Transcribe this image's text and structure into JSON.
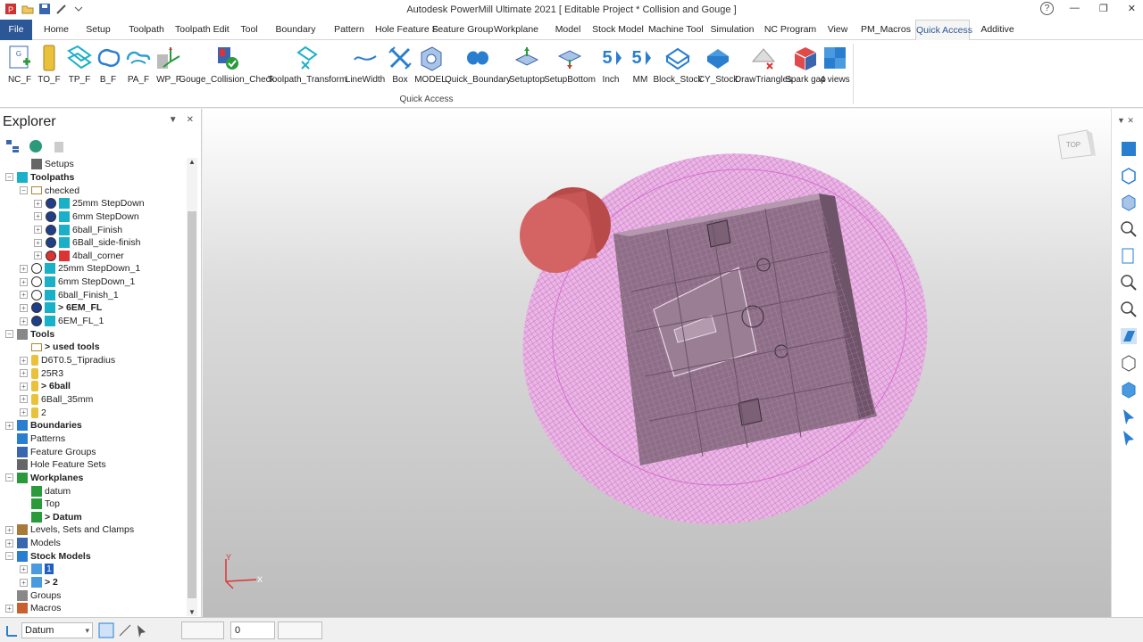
{
  "title": "Autodesk PowerMill Ultimate 2021    [ Editable Project * Collision and Gouge ]",
  "window_controls": [
    "—",
    "❐",
    "✕"
  ],
  "help": "?",
  "tabs": [
    "File",
    "Home",
    "Setup",
    "Toolpath",
    "Toolpath Edit",
    "Tool",
    "Boundary",
    "Pattern",
    "Hole Feature S",
    "Feature Group",
    "Workplane",
    "Model",
    "Stock Model",
    "Machine Tool",
    "Simulation",
    "NC Program",
    "View",
    "PM_Macros",
    "Quick Access",
    "Additive"
  ],
  "active_tab": "Quick Access",
  "ribbon": {
    "buttons": [
      "NC_F",
      "TO_F",
      "TP_F",
      "B_F",
      "PA_F",
      "WP_F",
      "Gouge_Collision_Check",
      "Toolpath_Transform",
      "LineWidth",
      "Box",
      "MODEL",
      "Quick_Boundary",
      "Setuptop",
      "SetupBottom",
      "Inch",
      "MM",
      "Block_Stock",
      "CY_Stock",
      "DrawTriangles",
      "Spark gap",
      "4 views"
    ],
    "group_label": "Quick Access"
  },
  "explorer": {
    "title": "Explorer",
    "tree": [
      {
        "label": "Setups",
        "level": 1,
        "bold": false,
        "exp": "·",
        "icon": "setups-icon"
      },
      {
        "label": "Toolpaths",
        "level": 0,
        "bold": true,
        "exp": "−",
        "icon": "toolpaths-icon"
      },
      {
        "label": "checked",
        "level": 1,
        "bold": false,
        "exp": "−",
        "icon": "folder-icon"
      },
      {
        "label": "25mm StepDown",
        "level": 2,
        "bold": false,
        "exp": "+",
        "icon": "toolpath-checked-icon"
      },
      {
        "label": "6mm StepDown",
        "level": 2,
        "bold": false,
        "exp": "+",
        "icon": "toolpath-checked-icon"
      },
      {
        "label": "6ball_Finish",
        "level": 2,
        "bold": false,
        "exp": "+",
        "icon": "toolpath-checked-icon"
      },
      {
        "label": "6Ball_side-finish",
        "level": 2,
        "bold": false,
        "exp": "+",
        "icon": "toolpath-checked-icon"
      },
      {
        "label": "4ball_corner",
        "level": 2,
        "bold": false,
        "exp": "+",
        "icon": "toolpath-error-icon"
      },
      {
        "label": "25mm StepDown_1",
        "level": 1,
        "bold": false,
        "exp": "+",
        "icon": "toolpath-icon"
      },
      {
        "label": "6mm StepDown_1",
        "level": 1,
        "bold": false,
        "exp": "+",
        "icon": "toolpath-icon"
      },
      {
        "label": "6ball_Finish_1",
        "level": 1,
        "bold": false,
        "exp": "+",
        "icon": "toolpath-icon"
      },
      {
        "label": "> 6EM_FL",
        "level": 1,
        "bold": true,
        "exp": "+",
        "icon": "toolpath-checked-icon"
      },
      {
        "label": "6EM_FL_1",
        "level": 1,
        "bold": false,
        "exp": "+",
        "icon": "toolpath-checked-icon"
      },
      {
        "label": "Tools",
        "level": 0,
        "bold": true,
        "exp": "−",
        "icon": "tools-icon"
      },
      {
        "label": "> used tools",
        "level": 1,
        "bold": true,
        "exp": "·",
        "icon": "folder-icon"
      },
      {
        "label": "D6T0.5_Tipradius",
        "level": 1,
        "bold": false,
        "exp": "+",
        "icon": "tool-icon"
      },
      {
        "label": "25R3",
        "level": 1,
        "bold": false,
        "exp": "+",
        "icon": "tool-icon"
      },
      {
        "label": "> 6ball",
        "level": 1,
        "bold": true,
        "exp": "+",
        "icon": "tool-icon"
      },
      {
        "label": "6Ball_35mm",
        "level": 1,
        "bold": false,
        "exp": "+",
        "icon": "tool-icon"
      },
      {
        "label": "2",
        "level": 1,
        "bold": false,
        "exp": "+",
        "icon": "tool-icon"
      },
      {
        "label": "Boundaries",
        "level": 0,
        "bold": true,
        "exp": "+",
        "icon": "boundaries-icon"
      },
      {
        "label": "Patterns",
        "level": 0,
        "bold": false,
        "exp": "·",
        "icon": "patterns-icon"
      },
      {
        "label": "Feature Groups",
        "level": 0,
        "bold": false,
        "exp": "·",
        "icon": "feature-groups-icon"
      },
      {
        "label": "Hole Feature Sets",
        "level": 0,
        "bold": false,
        "exp": "·",
        "icon": "hole-feature-icon"
      },
      {
        "label": "Workplanes",
        "level": 0,
        "bold": true,
        "exp": "−",
        "icon": "workplanes-icon"
      },
      {
        "label": "datum",
        "level": 1,
        "bold": false,
        "exp": "·",
        "icon": "workplane-icon"
      },
      {
        "label": "Top",
        "level": 1,
        "bold": false,
        "exp": "·",
        "icon": "workplane-icon"
      },
      {
        "label": "> Datum",
        "level": 1,
        "bold": true,
        "exp": "·",
        "icon": "workplane-icon"
      },
      {
        "label": "Levels, Sets and Clamps",
        "level": 0,
        "bold": false,
        "exp": "+",
        "icon": "levels-icon"
      },
      {
        "label": "Models",
        "level": 0,
        "bold": false,
        "exp": "+",
        "icon": "models-icon"
      },
      {
        "label": "Stock Models",
        "level": 0,
        "bold": true,
        "exp": "−",
        "icon": "stock-models-icon"
      },
      {
        "label": "1",
        "level": 1,
        "bold": false,
        "exp": "+",
        "icon": "stock-model-icon",
        "selected": true
      },
      {
        "label": "> 2",
        "level": 1,
        "bold": true,
        "exp": "+",
        "icon": "stock-model-icon"
      },
      {
        "label": "Groups",
        "level": 0,
        "bold": false,
        "exp": "·",
        "icon": "groups-icon"
      },
      {
        "label": "Macros",
        "level": 0,
        "bold": false,
        "exp": "+",
        "icon": "macros-icon"
      }
    ]
  },
  "viewport": {
    "viewcube_label": "TOP",
    "axis_x": "X",
    "axis_y": "Y"
  },
  "statusbar": {
    "workplane": "Datum",
    "value": "0"
  },
  "colors": {
    "file_tab": "#2b5797",
    "mesh": "#d040c8",
    "tool_disc": "#d05a5a",
    "part": "#8c6f86"
  }
}
